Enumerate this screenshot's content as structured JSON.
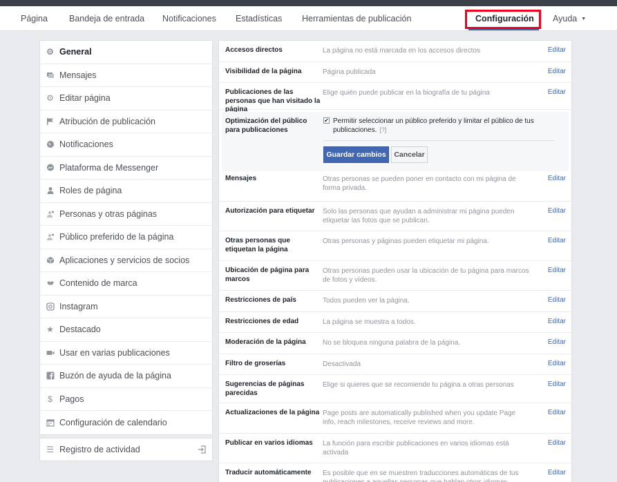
{
  "topnav": {
    "items": [
      {
        "label": "Página"
      },
      {
        "label": "Bandeja de entrada"
      },
      {
        "label": "Notificaciones"
      },
      {
        "label": "Estadísticas"
      },
      {
        "label": "Herramientas de publicación"
      },
      {
        "label": "Configuración",
        "active": true
      },
      {
        "label": "Ayuda",
        "icon": "caret-down-icon"
      }
    ]
  },
  "sidebar": {
    "items": [
      {
        "label": "General",
        "icon": "gear-icon",
        "active": true
      },
      {
        "label": "Mensajes",
        "icon": "message-icon"
      },
      {
        "label": "Editar página",
        "icon": "gear-icon"
      },
      {
        "label": "Atribución de publicación",
        "icon": "flag-icon"
      },
      {
        "label": "Notificaciones",
        "icon": "globe-icon"
      },
      {
        "label": "Plataforma de Messenger",
        "icon": "messenger-icon"
      },
      {
        "label": "Roles de página",
        "icon": "person-icon"
      },
      {
        "label": "Personas y otras páginas",
        "icon": "person-star-icon"
      },
      {
        "label": "Público preferido de la página",
        "icon": "person-star-icon"
      },
      {
        "label": "Aplicaciones y servicios de socios",
        "icon": "cube-icon"
      },
      {
        "label": "Contenido de marca",
        "icon": "handshake-icon"
      },
      {
        "label": "Instagram",
        "icon": "instagram-icon"
      },
      {
        "label": "Destacado",
        "icon": "star-icon"
      },
      {
        "label": "Usar en varias publicaciones",
        "icon": "video-icon"
      },
      {
        "label": "Buzón de ayuda de la página",
        "icon": "facebook-icon"
      },
      {
        "label": "Pagos",
        "icon": "dollar-icon"
      },
      {
        "label": "Configuración de calendario",
        "icon": "calendar-icon"
      }
    ],
    "activity_log": {
      "label": "Registro de actividad",
      "icon": "list-icon",
      "action_icon": "login-icon"
    }
  },
  "settings": {
    "edit_label": "Editar",
    "rows": [
      {
        "label": "Accesos directos",
        "value": "La página no está marcada en los accesos directos"
      },
      {
        "label": "Visibilidad de la página",
        "value": "Página publicada"
      },
      {
        "label": "Publicaciones de las personas que han visitado la página",
        "value": "Elige quién puede publicar en la biografía de tu página"
      },
      {
        "label": "Mensajes",
        "value": "Otras personas se pueden poner en contacto con mi página de forma privada."
      },
      {
        "label": "Autorización para etiquetar",
        "value": "Solo las personas que ayudan a administrar mi página pueden etiquetar las fotos que se publican."
      },
      {
        "label": "Otras personas que etiquetan la página",
        "value": "Otras personas y páginas pueden etiquetar mi página."
      },
      {
        "label": "Ubicación de página para marcos",
        "value": "Otras personas pueden usar la ubicación de tu página para marcos de fotos y vídeos."
      },
      {
        "label": "Restricciones de país",
        "value": "Todos pueden ver la página."
      },
      {
        "label": "Restricciones de edad",
        "value": "La página se muestra a todos."
      },
      {
        "label": "Moderación de la página",
        "value": "No se bloquea ninguna palabra de la página."
      },
      {
        "label": "Filtro de groserías",
        "value": "Desactivada"
      },
      {
        "label": "Sugerencias de páginas parecidas",
        "value": "Elige si quieres que se recomiende tu página a otras personas"
      },
      {
        "label": "Actualizaciones de la página",
        "value": "Page posts are automatically published when you update Page info, reach milestones, receive reviews and more."
      },
      {
        "label": "Publicar en varios idiomas",
        "value": "La función para escribir publicaciones en varios idiomas está activada"
      },
      {
        "label": "Traducir automáticamente",
        "value": "Es posible que en se muestren traducciones automáticas de tus publicaciones a aquellas personas que hablan otros idiomas"
      }
    ],
    "audience": {
      "label": "Optimización del público para publicaciones",
      "checkbox_text": "Permitir seleccionar un público preferido y limitar el público de tus publicaciones.",
      "checked": true,
      "help": "[?]",
      "save_label": "Guardar cambios",
      "cancel_label": "Cancelar"
    }
  },
  "colors": {
    "accent": "#4267b2",
    "highlight_box": "#f0001a"
  }
}
